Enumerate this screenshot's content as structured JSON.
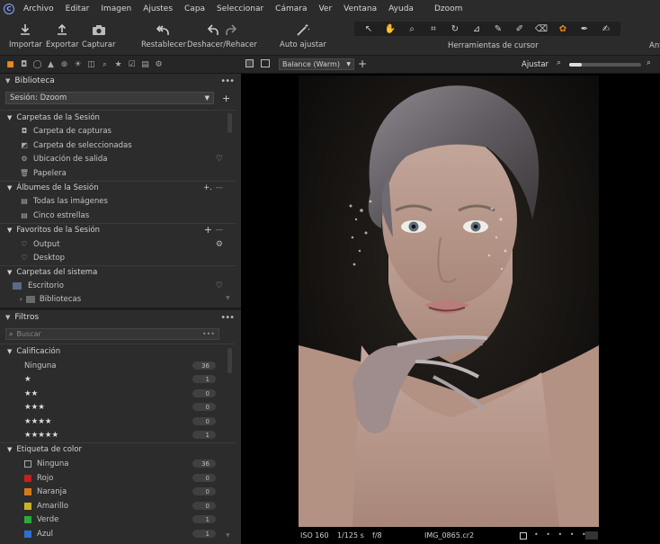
{
  "menubar": {
    "items": [
      "Archivo",
      "Editar",
      "Imagen",
      "Ajustes",
      "Capa",
      "Seleccionar",
      "Cámara",
      "Ver",
      "Ventana",
      "Ayuda"
    ],
    "app_title": "Dzoom"
  },
  "toolbar": {
    "import": "Importar",
    "export": "Exportar",
    "capture": "Capturar",
    "reset": "Restablecer",
    "undo_redo": "Deshacer/Rehacer",
    "auto_adjust": "Auto ajustar",
    "cursor_tools_label": "Herramientas de cursor",
    "right_cut": "Ant"
  },
  "library": {
    "title": "Biblioteca",
    "session_select": "Sesión: Dzoom",
    "groups": [
      {
        "label": "Carpetas de la Sesión",
        "items": [
          "Carpeta de capturas",
          "Carpeta de seleccionadas",
          "Ubicación de salida",
          "Papelera"
        ]
      },
      {
        "label": "Álbumes de la Sesión",
        "items": [
          "Todas las imágenes",
          "Cinco estrellas"
        ]
      },
      {
        "label": "Favoritos de la Sesión",
        "items": [
          "Output",
          "Desktop"
        ]
      },
      {
        "label": "Carpetas del sistema",
        "items": [
          "Escritorio",
          "Bibliotecas"
        ]
      }
    ]
  },
  "filters": {
    "title": "Filtros",
    "search_placeholder": "Buscar",
    "rating": {
      "label": "Calificación",
      "rows": [
        {
          "label": "Ninguna",
          "count": "36"
        },
        {
          "label": "★",
          "count": "1"
        },
        {
          "label": "★★",
          "count": "0"
        },
        {
          "label": "★★★",
          "count": "0"
        },
        {
          "label": "★★★★",
          "count": "0"
        },
        {
          "label": "★★★★★",
          "count": "1"
        }
      ]
    },
    "color_label": {
      "label": "Etiqueta de color",
      "rows": [
        {
          "label": "Ninguna",
          "count": "36",
          "color": "#2c2c2c"
        },
        {
          "label": "Rojo",
          "count": "0",
          "color": "#c81e1e"
        },
        {
          "label": "Naranja",
          "count": "0",
          "color": "#d47a1a"
        },
        {
          "label": "Amarillo",
          "count": "0",
          "color": "#c8b41e"
        },
        {
          "label": "Verde",
          "count": "1",
          "color": "#2ea83a"
        },
        {
          "label": "Azul",
          "count": "1",
          "color": "#2f6fd0"
        }
      ]
    }
  },
  "viewer": {
    "style_select": "Balance (Warm)",
    "adjust_label": "Ajustar",
    "iso": "ISO 160",
    "shutter": "1/125 s",
    "aperture": "f/8",
    "filename": "IMG_0865.cr2"
  },
  "colors": {
    "accent": "#e8891c",
    "panel": "#2c2c2c",
    "viewer_bg": "#000000"
  }
}
